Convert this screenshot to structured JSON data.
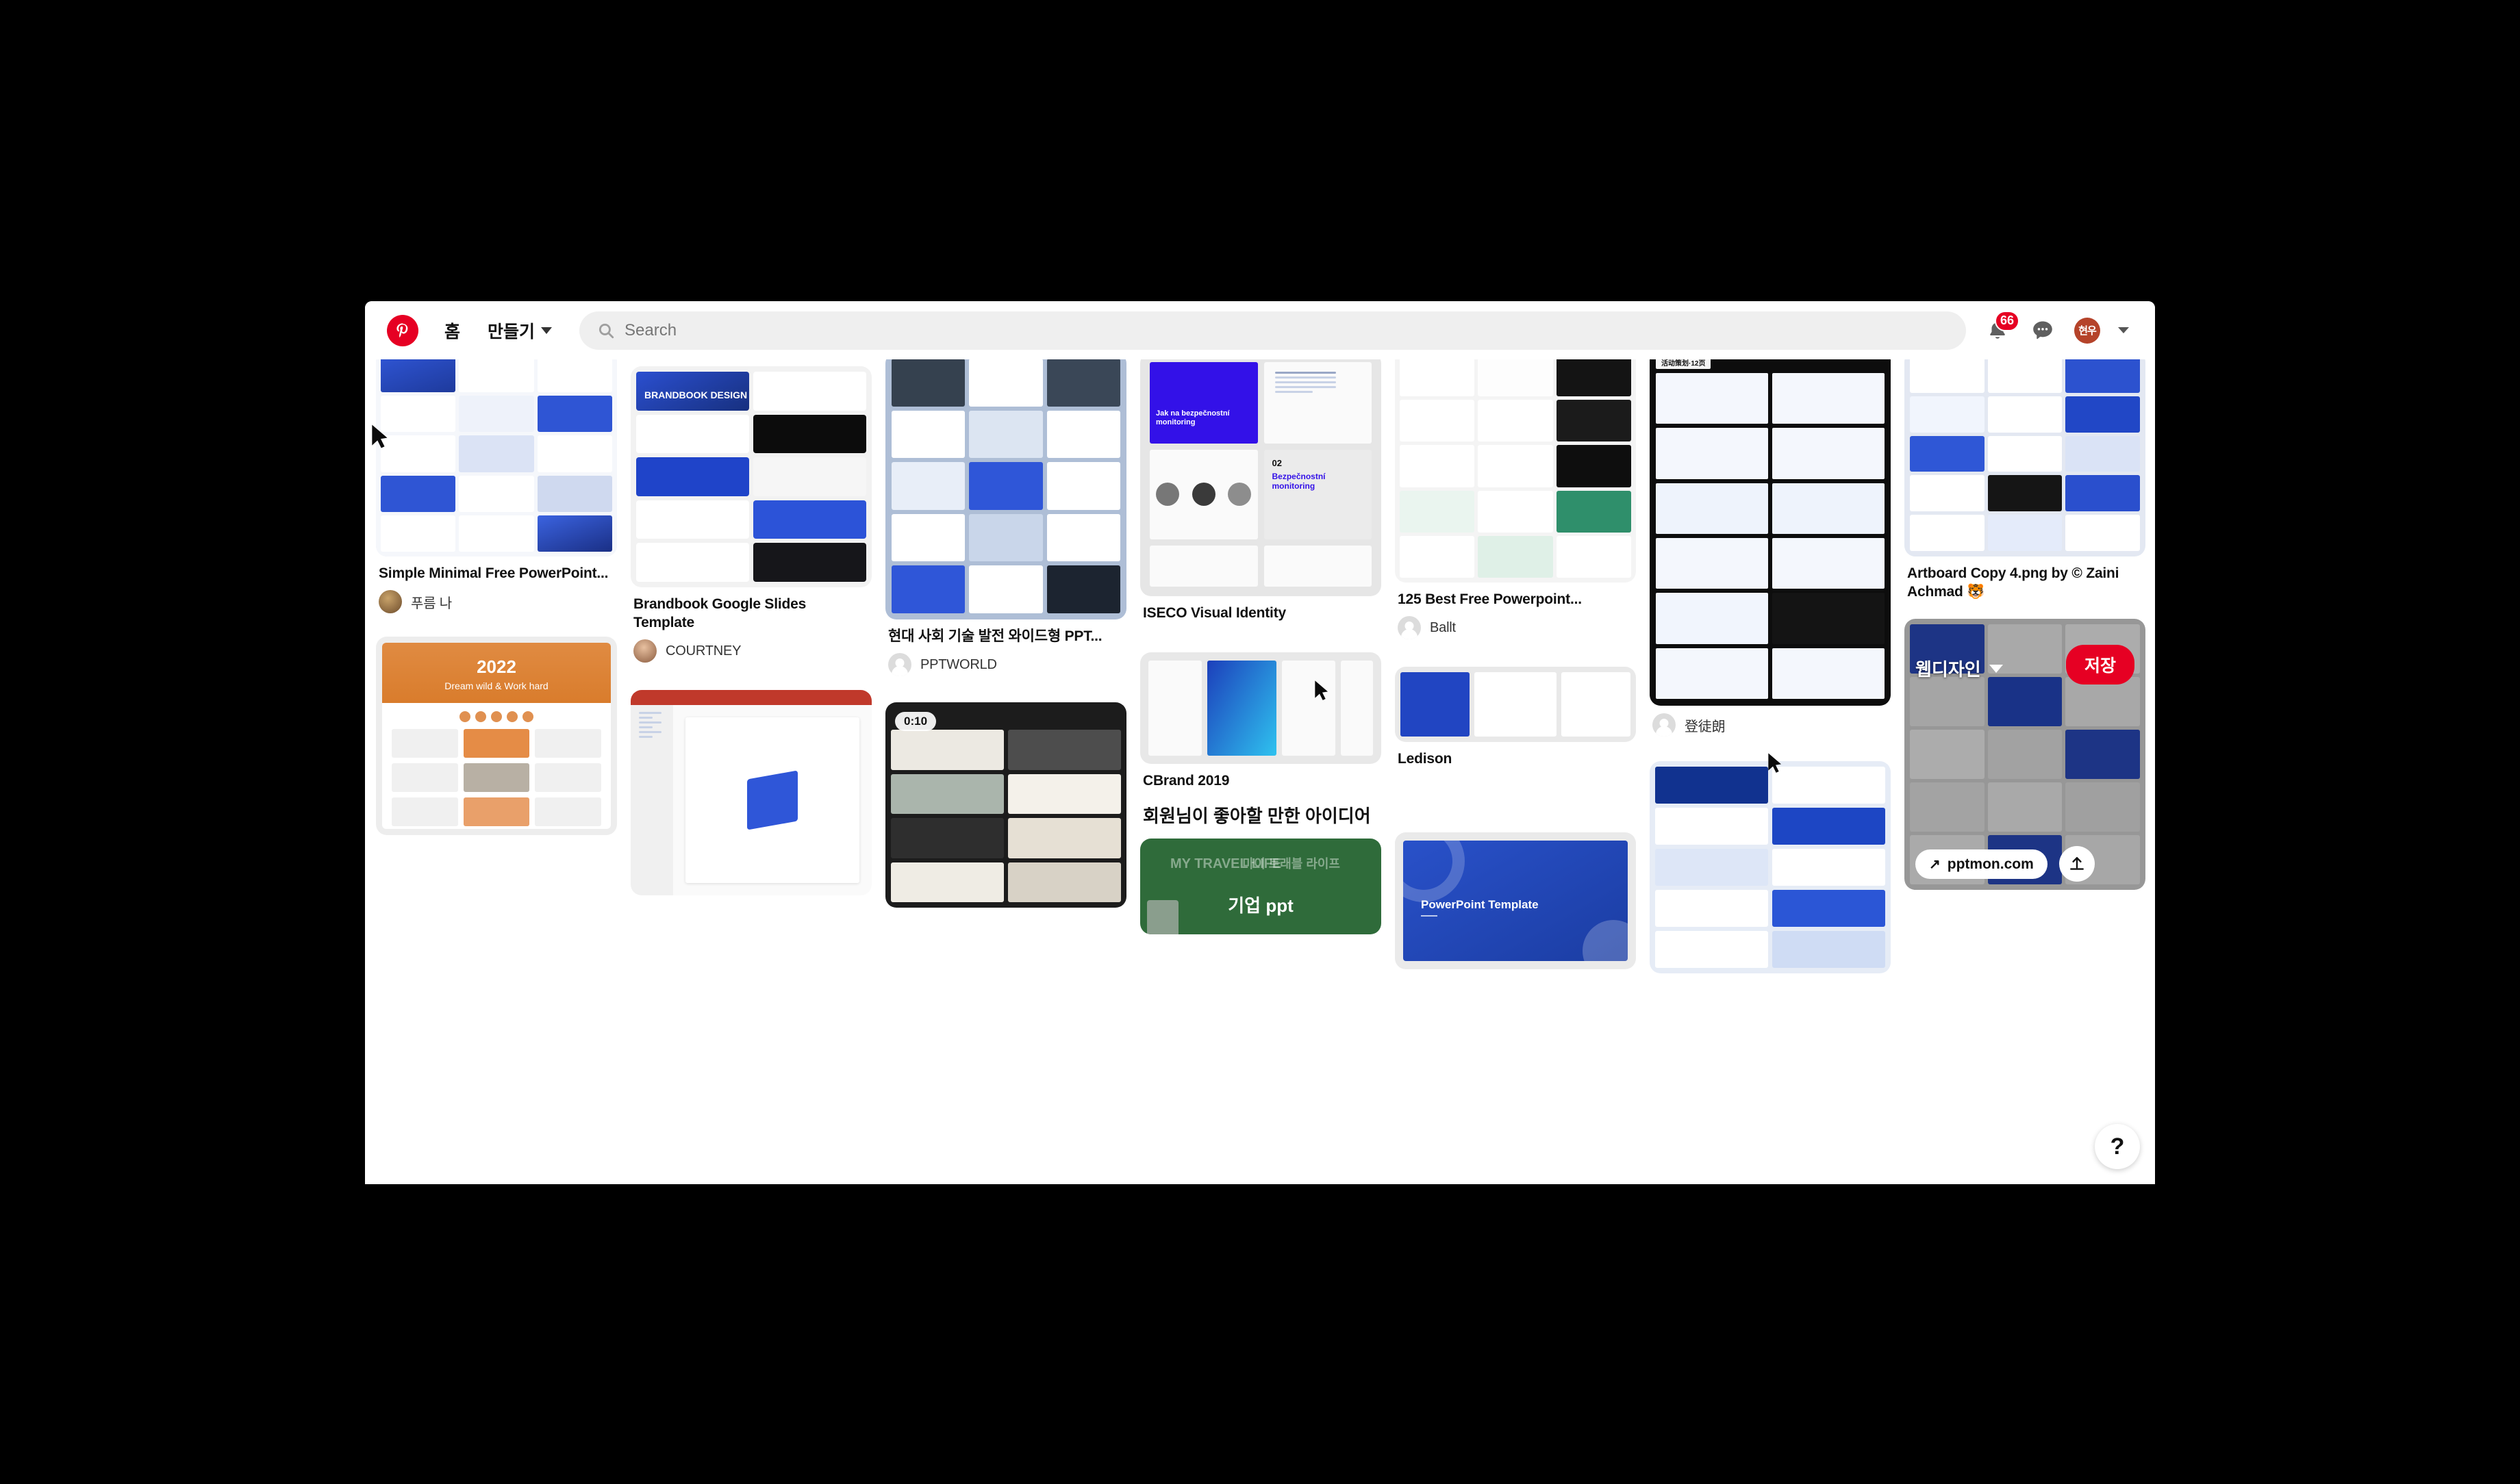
{
  "header": {
    "logo_alt": "Pinterest",
    "home_label": "홈",
    "create_label": "만들기",
    "search_placeholder": "Search",
    "search_value": "",
    "notification_count": "66",
    "avatar_initials": "현우"
  },
  "section_heading": "회원님이 좋아할 만한 아이디어",
  "hover_pin": {
    "board_name": "웹디자인",
    "save_label": "저장",
    "link_domain": "pptmon.com",
    "help_label": "?"
  },
  "pins": [
    {
      "id": "pin-simple-minimal",
      "title": "Simple Minimal Free PowerPoint...",
      "author": "푸름 나",
      "has_author_photo": true,
      "column": 0
    },
    {
      "id": "pin-2022-dream",
      "title": "",
      "author": "",
      "overlay_year": "2022",
      "overlay_tagline": "Dream wild & Work hard",
      "column": 0
    },
    {
      "id": "pin-brandbook",
      "title": "Brandbook Google Slides Template",
      "author": "COURTNEY",
      "has_author_photo": true,
      "overlay_text": "BRANDBOOK DESIGN",
      "column": 1
    },
    {
      "id": "pin-ppt-editor",
      "title": "",
      "author": "",
      "column": 1
    },
    {
      "id": "pin-hyundai-wide",
      "title": "현대 사회 기술 발전 와이드형 PPT...",
      "author": "PPTWORLD",
      "has_author_photo": false,
      "column": 2
    },
    {
      "id": "pin-strategy-video",
      "title": "",
      "author": "",
      "duration": "0:10",
      "column": 2
    },
    {
      "id": "pin-iseco",
      "title": "ISECO Visual Identity",
      "author": "",
      "overlay_text": "Jak na bezpečnostní monitoring",
      "overlay_sub": "02 Bezpečnostní monitoring",
      "column": 3
    },
    {
      "id": "pin-cbrand",
      "title": "CBrand 2019",
      "author": "",
      "column": 3
    },
    {
      "id": "pin-travel-green",
      "title": "",
      "author": "",
      "overlay_text": "MY TRAVEL LIFE",
      "overlay_sub": "마이 트래블 라이프",
      "overlay_tag": "기업 ppt",
      "column": 3
    },
    {
      "id": "pin-125-best",
      "title": "125 Best Free Powerpoint...",
      "author": "Ballt",
      "has_author_photo": false,
      "column": 4
    },
    {
      "id": "pin-ledison",
      "title": "Ledison",
      "author": "",
      "column": 4
    },
    {
      "id": "pin-powerpoint-template",
      "title": "",
      "author": "",
      "overlay_text": "PowerPoint Template",
      "column": 4
    },
    {
      "id": "pin-chinese-deck",
      "title": "",
      "author": "登徒朗",
      "has_author_photo": false,
      "overlay_text": "活动策划·12页",
      "column": 5
    },
    {
      "id": "pin-blue-deck",
      "title": "",
      "author": "",
      "column": 5
    },
    {
      "id": "pin-artboard",
      "title": "Artboard Copy 4.png by © Zaini Achmad 🐯",
      "author": "",
      "column": 6
    },
    {
      "id": "pin-webdesign-hover",
      "title": "",
      "author": "",
      "column": 6,
      "hovered": true
    }
  ],
  "colors": {
    "brand_red": "#e60023",
    "page_bg": "#ffffff",
    "desktop_bg": "#000000",
    "text_primary": "#111111",
    "text_secondary": "#767676"
  }
}
